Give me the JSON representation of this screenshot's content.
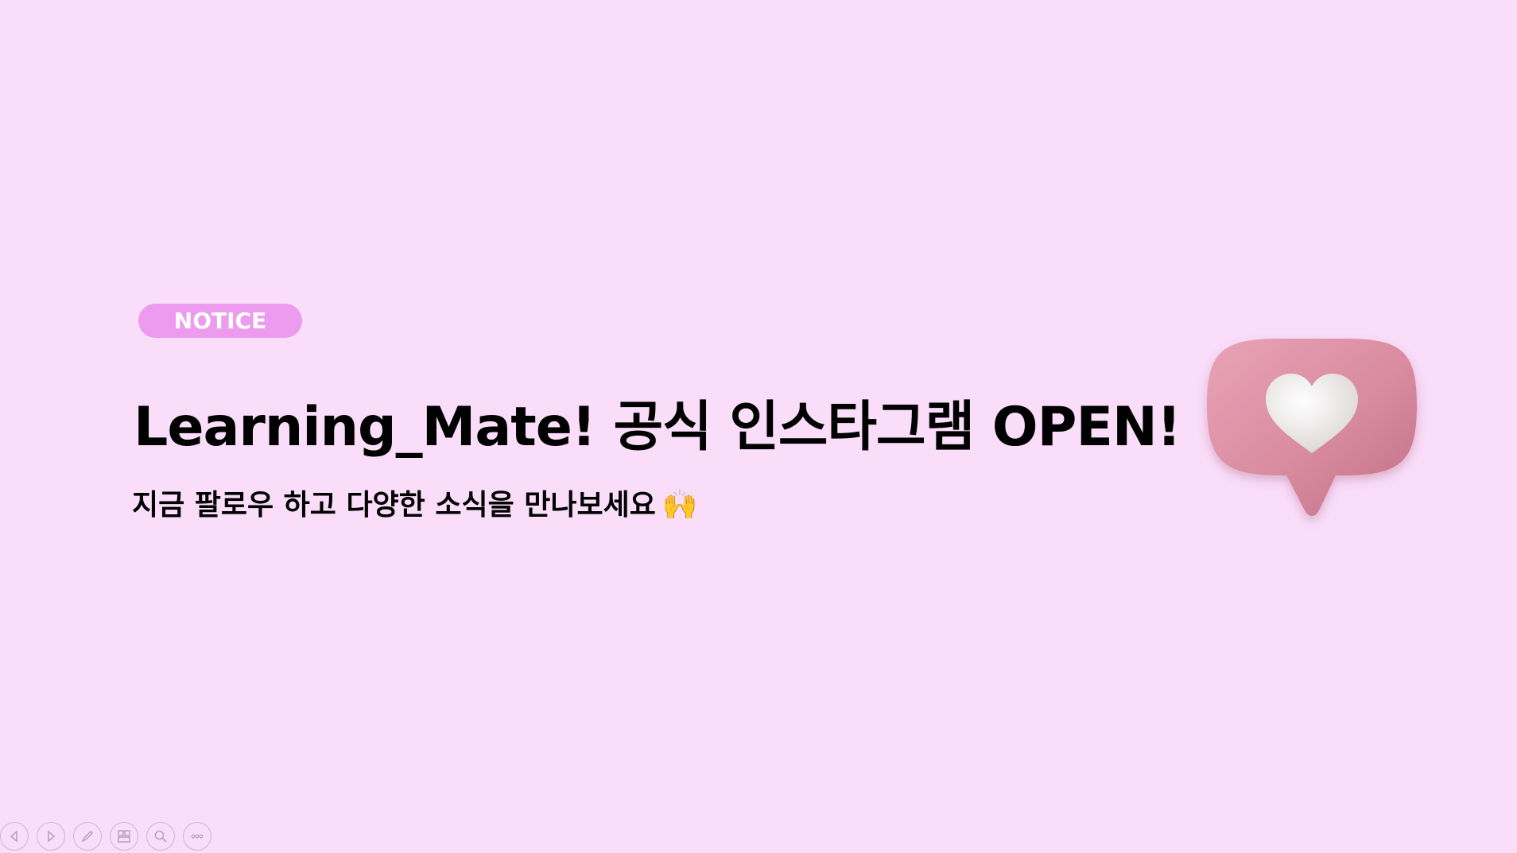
{
  "slide": {
    "background": "#F9DDF9",
    "badge": {
      "label": "NOTICE",
      "color": "#EC9BEE"
    },
    "headline": "Learning_Mate! 공식 인스타그램 OPEN!",
    "subline": "지금 팔로우 하고 다양한 소식을 만나보세요",
    "subline_emoji": "🙌",
    "illustration": {
      "icon": "heart-speech-bubble-icon",
      "bubble_color": "#D98BA0",
      "heart_color": "#F2EEEE"
    }
  },
  "toolbar": {
    "buttons": [
      {
        "icon": "previous-slide-icon"
      },
      {
        "icon": "next-slide-icon"
      },
      {
        "icon": "pen-icon"
      },
      {
        "icon": "slide-overview-icon"
      },
      {
        "icon": "zoom-icon"
      },
      {
        "icon": "more-options-icon"
      }
    ]
  }
}
